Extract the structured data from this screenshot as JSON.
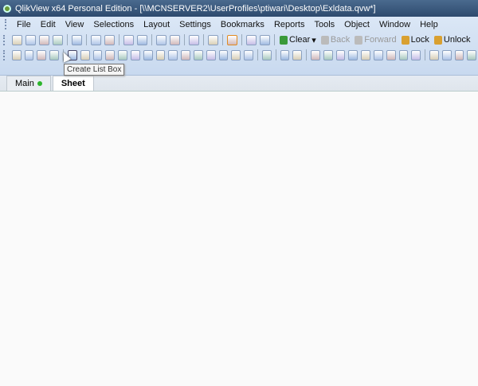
{
  "window": {
    "title": "QlikView x64 Personal Edition - [\\\\MCNSERVER2\\UserProfiles\\ptiwari\\Desktop\\Exldata.qvw*]"
  },
  "menu": [
    "File",
    "Edit",
    "View",
    "Selections",
    "Layout",
    "Settings",
    "Bookmarks",
    "Reports",
    "Tools",
    "Object",
    "Window",
    "Help"
  ],
  "toolbar1": {
    "icons": [
      "new-icon",
      "open-icon",
      "reload-icon",
      "save-icon",
      "|",
      "print-icon",
      "|",
      "edit-script-icon",
      "export-icon",
      "|",
      "undo-icon",
      "redo-icon",
      "|",
      "search-icon",
      "select-icon",
      "|",
      "chart-wizard-icon",
      "|",
      "favorites-icon",
      "|",
      "design-grid-icon",
      "|",
      "help-icon",
      "whats-this-icon"
    ],
    "clear": "Clear",
    "back": "Back",
    "forward": "Forward",
    "lock": "Lock",
    "unlock": "Unlock"
  },
  "toolbar2": {
    "icons": [
      "new-sheet-icon",
      "promote-sheet-icon",
      "demote-sheet-icon",
      "sheet-props-icon",
      "|",
      "list-box-icon",
      "statistics-box-icon",
      "multi-box-icon",
      "table-box-icon",
      "chart-icon",
      "input-box-icon",
      "current-selections-icon",
      "button-icon",
      "text-object-icon",
      "line-arrow-icon",
      "slider-icon",
      "bookmark-object-icon",
      "search-object-icon",
      "container-icon",
      "custom-object-icon",
      "|",
      "chart-wizard-icon",
      "|",
      "format-painter-icon",
      "bring-front-icon",
      "|",
      "align-left-icon",
      "align-center-icon",
      "align-right-icon",
      "align-top-icon",
      "align-middle-icon",
      "align-bottom-icon",
      "space-horiz-icon",
      "space-vert-icon",
      "adjust-icon",
      "|",
      "server-objects-icon",
      "share-icon",
      "edit-icon",
      "connect-icon"
    ]
  },
  "tabs": [
    {
      "label": "Main"
    },
    {
      "label": "Sheet"
    }
  ],
  "tooltip": "Create List Box"
}
